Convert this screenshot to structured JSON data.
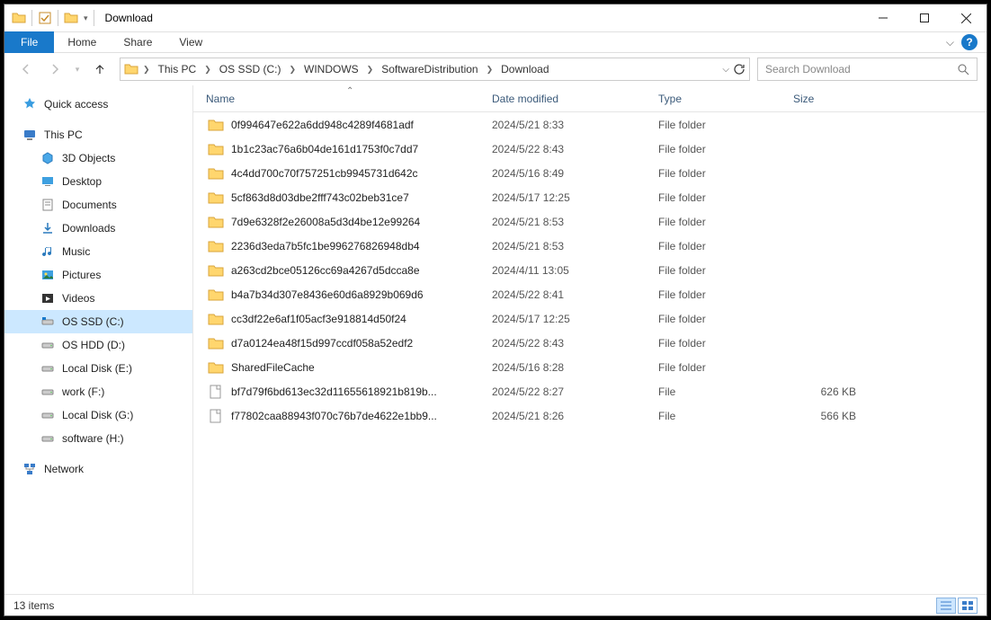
{
  "title": "Download",
  "ribbon": {
    "file": "File",
    "tabs": [
      "Home",
      "Share",
      "View"
    ]
  },
  "breadcrumb": [
    "This PC",
    "OS SSD (C:)",
    "WINDOWS",
    "SoftwareDistribution",
    "Download"
  ],
  "search_placeholder": "Search Download",
  "sidebar": {
    "quick_access": "Quick access",
    "this_pc": "This PC",
    "items": [
      "3D Objects",
      "Desktop",
      "Documents",
      "Downloads",
      "Music",
      "Pictures",
      "Videos",
      "OS SSD (C:)",
      "OS HDD (D:)",
      "Local Disk (E:)",
      "work (F:)",
      "Local Disk (G:)",
      "software (H:)"
    ],
    "network": "Network"
  },
  "columns": {
    "name": "Name",
    "date": "Date modified",
    "type": "Type",
    "size": "Size"
  },
  "rows": [
    {
      "icon": "folder",
      "name": "0f994647e622a6dd948c4289f4681adf",
      "date": "2024/5/21 8:33",
      "type": "File folder",
      "size": ""
    },
    {
      "icon": "folder",
      "name": "1b1c23ac76a6b04de161d1753f0c7dd7",
      "date": "2024/5/22 8:43",
      "type": "File folder",
      "size": ""
    },
    {
      "icon": "folder",
      "name": "4c4dd700c70f757251cb9945731d642c",
      "date": "2024/5/16 8:49",
      "type": "File folder",
      "size": ""
    },
    {
      "icon": "folder",
      "name": "5cf863d8d03dbe2fff743c02beb31ce7",
      "date": "2024/5/17 12:25",
      "type": "File folder",
      "size": ""
    },
    {
      "icon": "folder",
      "name": "7d9e6328f2e26008a5d3d4be12e99264",
      "date": "2024/5/21 8:53",
      "type": "File folder",
      "size": ""
    },
    {
      "icon": "folder",
      "name": "2236d3eda7b5fc1be996276826948db4",
      "date": "2024/5/21 8:53",
      "type": "File folder",
      "size": ""
    },
    {
      "icon": "folder",
      "name": "a263cd2bce05126cc69a4267d5dcca8e",
      "date": "2024/4/11 13:05",
      "type": "File folder",
      "size": ""
    },
    {
      "icon": "folder",
      "name": "b4a7b34d307e8436e60d6a8929b069d6",
      "date": "2024/5/22 8:41",
      "type": "File folder",
      "size": ""
    },
    {
      "icon": "folder",
      "name": "cc3df22e6af1f05acf3e918814d50f24",
      "date": "2024/5/17 12:25",
      "type": "File folder",
      "size": ""
    },
    {
      "icon": "folder",
      "name": "d7a0124ea48f15d997ccdf058a52edf2",
      "date": "2024/5/22 8:43",
      "type": "File folder",
      "size": ""
    },
    {
      "icon": "folder",
      "name": "SharedFileCache",
      "date": "2024/5/16 8:28",
      "type": "File folder",
      "size": ""
    },
    {
      "icon": "file",
      "name": "bf7d79f6bd613ec32d11655618921b819b...",
      "date": "2024/5/22 8:27",
      "type": "File",
      "size": "626 KB"
    },
    {
      "icon": "file",
      "name": "f77802caa88943f070c76b7de4622e1bb9...",
      "date": "2024/5/21 8:26",
      "type": "File",
      "size": "566 KB"
    }
  ],
  "status": "13 items"
}
